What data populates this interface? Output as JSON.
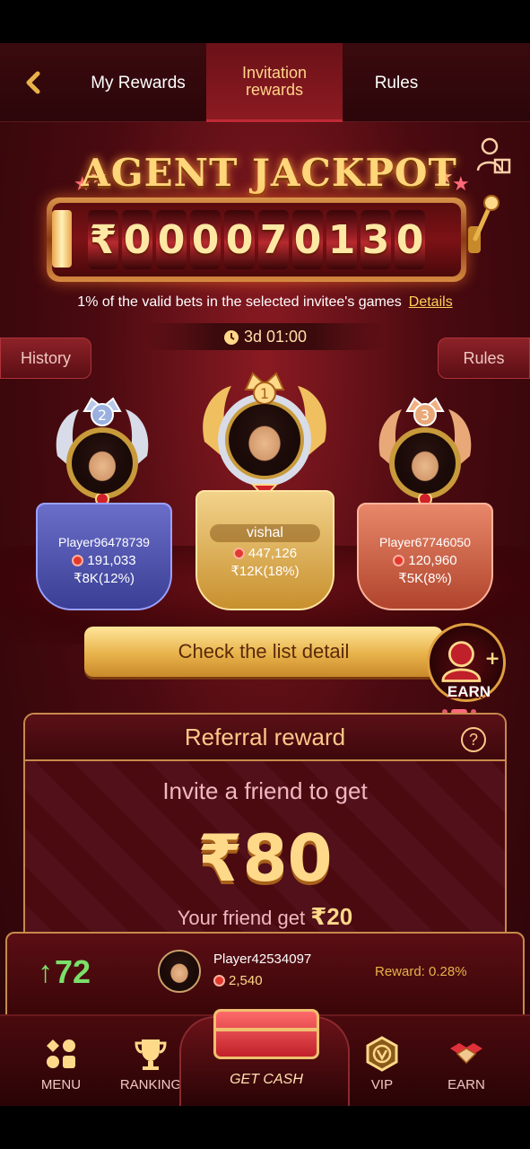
{
  "header": {
    "tabs": [
      {
        "label": "My Rewards",
        "active": false
      },
      {
        "label": "Invitation rewards",
        "active": true
      },
      {
        "label": "Rules",
        "active": false
      }
    ]
  },
  "jackpot": {
    "title": "AGENT JACKPOT",
    "currency": "₹",
    "digits": [
      "0",
      "0",
      "0",
      "0",
      "7",
      "0",
      "1",
      "3",
      "0"
    ],
    "description": "1% of the valid bets in the selected invitee's games",
    "details_link": "Details",
    "timer": "3d 01:00",
    "history_label": "History",
    "rules_label": "Rules"
  },
  "leaders": [
    {
      "rank": "2",
      "name": "Player96478739",
      "score": "191,033",
      "reward": "₹8K(12%)"
    },
    {
      "rank": "1",
      "name": "vishal",
      "score": "447,126",
      "reward": "₹12K(18%)"
    },
    {
      "rank": "3",
      "name": "Player67746050",
      "score": "120,960",
      "reward": "₹5K(8%)"
    }
  ],
  "check_list_label": "Check the list detail",
  "earn_badge": "EARN",
  "referral": {
    "title": "Referral reward",
    "invite_text": "Invite a friend to get",
    "amount": "₹80",
    "friend_text": "Your friend get",
    "friend_amount": "₹20"
  },
  "info_bar": {
    "count": "72",
    "player": "Player42534097",
    "score": "2,540",
    "reward": "Reward: 0.28%"
  },
  "nav": {
    "menu": "MENU",
    "ranking": "RANKING",
    "get_cash": "GET CASH",
    "vip": "VIP",
    "earn": "EARN"
  },
  "colors": {
    "accent_gold": "#ffd98a",
    "background_red": "#4a0a10",
    "green_up": "#7ae06a"
  }
}
